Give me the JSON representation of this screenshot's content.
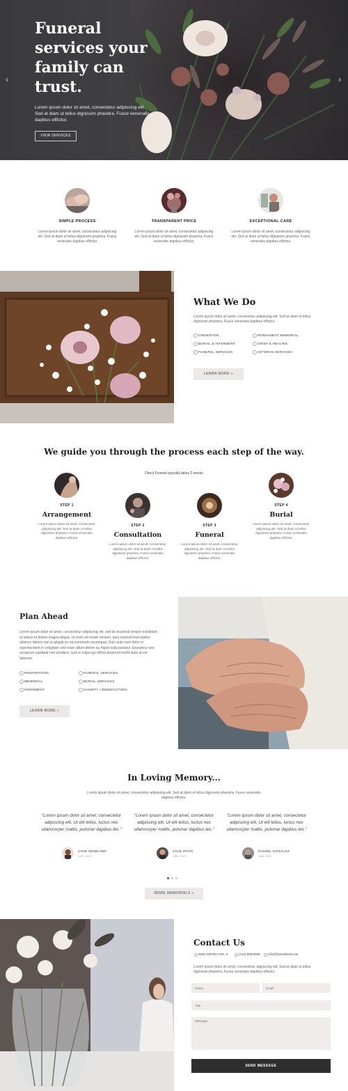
{
  "hero": {
    "title": "Funeral services your family can trust.",
    "text": "Lorem ipsum dolor sit amet, consectetur adipiscing elit. Sed at diam ut tellus dignissim pharetra. Fusce venenatis dapibus efficitur.",
    "button": "VIEW SERVICES",
    "prev_icon": "‹",
    "next_icon": "›"
  },
  "features": [
    {
      "title": "SIMPLE PROCESS",
      "text": "Lorem ipsum dolor sit amet, consectetur adipiscing elit. Sed at diam ut tellus dignissim pharetra. Fusce venenatis dapibus efficitur."
    },
    {
      "title": "TRANSPARENT PRICE",
      "text": "Lorem ipsum dolor sit amet, consectetur adipiscing elit. Sed at diam ut tellus dignissim pharetra. Fusce venenatis dapibus efficitur."
    },
    {
      "title": "EXCEPTIONAL CARE",
      "text": "Lorem ipsum dolor sit amet, consectetur adipiscing elit. Sed at diam ut tellus dignissim pharetra. Fusce venenatis dapibus efficitur."
    }
  ],
  "what_we_do": {
    "title": "What We Do",
    "text": "Lorem ipsum dolor sit amet, consectetur adipiscing elit. Sed at diam ut tellus dignissim pharetra. Fusce venenatis dapibus efficitur.",
    "services": [
      "CREMATION",
      "PERMANENT MEMORIAL",
      "BURIAL & INTERMENT",
      "GRIEF & HEALING",
      "FUNERAL SERVICES",
      "VETERAN SERVICES"
    ],
    "button": "LEARN MORE   »"
  },
  "process": {
    "title": "We guide you through the process each step of the way.",
    "subtitle": "Direct Funeral typically takes 2 weeks",
    "steps": [
      {
        "num": "STEP 1",
        "title": "Arrangement",
        "text": "Lorem ipsum dolor sit amet, consectetur adipiscing elit. Sed at diam ut tellus dignissim pharetra. Fusce venenatis dapibus efficitur."
      },
      {
        "num": "STEP 2",
        "title": "Consultation",
        "text": "Lorem ipsum dolor sit amet, consectetur adipiscing elit. Sed at diam ut tellus dignissim pharetra. Fusce venenatis dapibus efficitur."
      },
      {
        "num": "STEP 3",
        "title": "Funeral",
        "text": "Lorem ipsum dolor sit amet, consectetur adipiscing elit. Sed at diam ut tellus dignissim pharetra. Fusce venenatis dapibus efficitur."
      },
      {
        "num": "STEP 4",
        "title": "Burial",
        "text": "Lorem ipsum dolor sit amet, consectetur adipiscing elit. Sed at diam ut tellus dignissim pharetra. Fusce venenatis dapibus efficitur."
      }
    ]
  },
  "plan_ahead": {
    "title": "Plan Ahead",
    "text": "Lorem ipsum dolor sit amet, consectetur adipiscing elit, sed do eiusmod tempor incididunt ut labore et dolore magna aliqua. Ut enim ad minim veniam, quis nostrud exercitation ullamco laboris nisi ut aliquip ex ea commodo consequat. Duis aute irure dolor in reprehenderit in voluptate velit esse cillum dolore eu fugiat nulla pariatur. Excepteur sint occaecat cupidatat non proident, sunt in culpa qui officia deserunt mollit anim id est laborum.",
    "items": [
      "PREPARATION",
      "FUNERAL SERVICES",
      "MEMORIAL",
      "BURIAL SERVICES",
      "INTERMENT",
      "CHARITY / BENEFACTORS"
    ],
    "button": "LEARN MORE   »"
  },
  "memory": {
    "title": "In Loving Memory...",
    "subtitle": "Lorem ipsum dolor sit amet, consectetur adipiscing elit. Sed at diam ut tellus dignissim pharetra. Fusce venenatis dapibus efficitur.",
    "testimonials": [
      {
        "quote": "“Lorem ipsum dolor sit amet, consectetur adipiscing elit. Ut elit tellus, luctus nec ullamcorper mattis, pulvinar dapibus leo.”",
        "name": "JANE NEWLAND",
        "years": "1979 - 2019"
      },
      {
        "quote": "“Lorem ipsum dolor sit amet, consectetur adipiscing elit. Ut elit tellus, luctus nec ullamcorper mattis, pulvinar dapibus leo.”",
        "name": "JACK RYAN",
        "years": "1955 - 2019"
      },
      {
        "quote": "“Lorem ipsum dolor sit amet, consectetur adipiscing elit. Ut elit tellus, luctus nec ullamcorper mattis, pulvinar dapibus leo.”",
        "name": "DANIEL GOZALEZ",
        "years": "1964 - 2019"
      }
    ],
    "button": "MORE MEMORIALS   »"
  },
  "contact": {
    "title": "Contact Us",
    "address": "4840 GRAND AVE. S",
    "phone": "(412) 555-5555",
    "email": "info@funeralhome.de",
    "text": "Lorem ipsum dolor sit amet, consectetur adipiscing elit. Sed at diam ut tellus dignissim pharetra. Fusce venenatis dapibus efficitur.",
    "name_placeholder": "Name",
    "email_placeholder": "Email",
    "title_placeholder": "Title",
    "message_placeholder": "Message",
    "button": "SEND MESSAGE"
  }
}
